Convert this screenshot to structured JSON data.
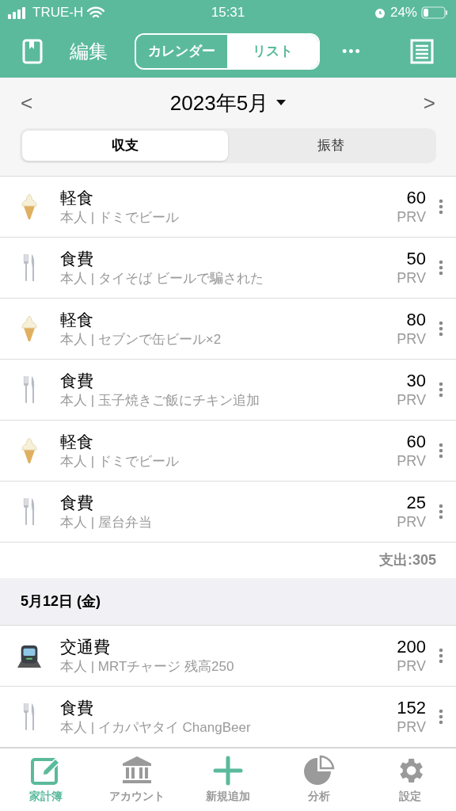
{
  "status_bar": {
    "carrier": "TRUE-H",
    "time": "15:31",
    "battery": "24%"
  },
  "header": {
    "edit": "編集",
    "view_tabs": [
      {
        "label": "カレンダー",
        "selected": false
      },
      {
        "label": "リスト",
        "selected": true
      }
    ],
    "more": "•••"
  },
  "month_nav": {
    "prev": "<",
    "title": "2023年5月",
    "next": ">"
  },
  "type_tabs": [
    {
      "label": "収支",
      "selected": true
    },
    {
      "label": "振替",
      "selected": false
    }
  ],
  "sections": [
    {
      "items": [
        {
          "kind": "snack",
          "category": "軽食",
          "memo": "本人 | ドミでビール",
          "amount": "60",
          "currency": "PRV"
        },
        {
          "kind": "food",
          "category": "食費",
          "memo": "本人 | タイそば ビールで騙された",
          "amount": "50",
          "currency": "PRV"
        },
        {
          "kind": "snack",
          "category": "軽食",
          "memo": "本人 | セブンで缶ビール×2",
          "amount": "80",
          "currency": "PRV"
        },
        {
          "kind": "food",
          "category": "食費",
          "memo": "本人 | 玉子焼きご飯にチキン追加",
          "amount": "30",
          "currency": "PRV"
        },
        {
          "kind": "snack",
          "category": "軽食",
          "memo": "本人 | ドミでビール",
          "amount": "60",
          "currency": "PRV"
        },
        {
          "kind": "food",
          "category": "食費",
          "memo": "本人 | 屋台弁当",
          "amount": "25",
          "currency": "PRV"
        }
      ],
      "total": "支出:305"
    },
    {
      "date": "5月12日 (金)",
      "items": [
        {
          "kind": "transport",
          "category": "交通費",
          "memo": "本人 | MRTチャージ 残高250",
          "amount": "200",
          "currency": "PRV"
        },
        {
          "kind": "food",
          "category": "食費",
          "memo": "本人 | イカパヤタイ ChangBeer",
          "amount": "152",
          "currency": "PRV"
        }
      ]
    }
  ],
  "tab_bar": [
    {
      "kind": "book",
      "label": "家計簿",
      "selected": true
    },
    {
      "kind": "account",
      "label": "アカウント",
      "selected": false
    },
    {
      "kind": "add",
      "label": "新規追加",
      "selected": false
    },
    {
      "kind": "analysis",
      "label": "分析",
      "selected": false
    },
    {
      "kind": "settings",
      "label": "設定",
      "selected": false
    }
  ]
}
